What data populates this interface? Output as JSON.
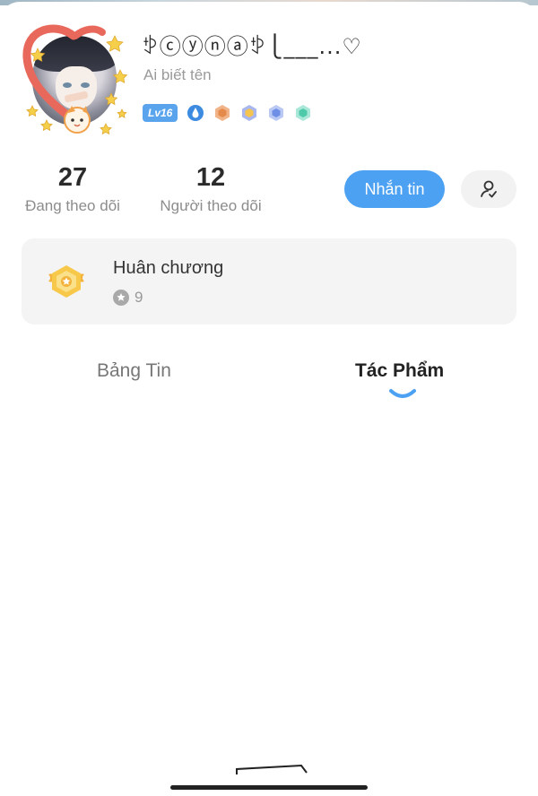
{
  "profile": {
    "name": "ꉣⓒⓨⓝⓐꉣ⎩___...♡",
    "subtitle": "Ai biết tên",
    "level": "Lv16"
  },
  "stats": {
    "following_count": "27",
    "following_label": "Đang theo dõi",
    "followers_count": "12",
    "followers_label": "Người theo dõi"
  },
  "actions": {
    "message_label": "Nhắn tin"
  },
  "medals": {
    "title": "Huân chương",
    "count": "9"
  },
  "tabs": [
    {
      "label": "Bảng Tin",
      "active": false
    },
    {
      "label": "Tác Phẩm",
      "active": true
    }
  ],
  "colors": {
    "accent": "#4da1f2",
    "card_bg": "#f4f4f4",
    "text_dark": "#2b2b2b",
    "text_muted": "#8c8c8c"
  }
}
